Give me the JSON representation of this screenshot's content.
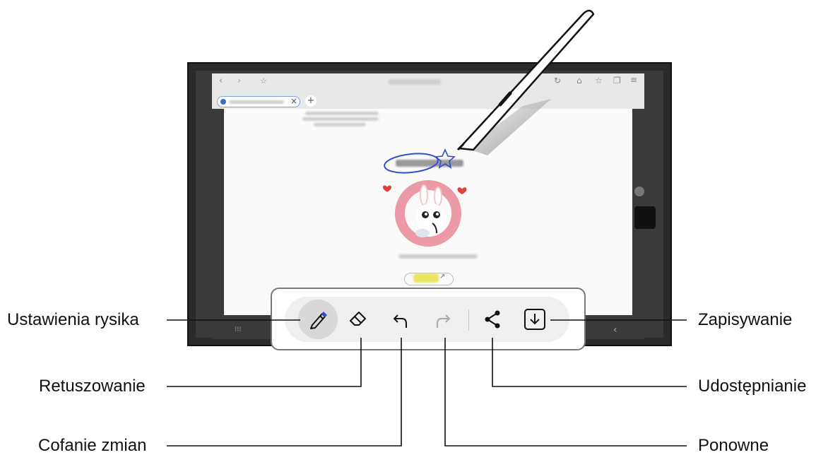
{
  "labels": {
    "pen_settings": "Ustawienia rysika",
    "eraser": "Retuszowanie",
    "undo": "Cofanie zmian",
    "save": "Zapisywanie",
    "share": "Udostępnianie",
    "redo": "Ponowne"
  },
  "toolbar": {
    "buttons": [
      {
        "name": "pen-settings",
        "icon": "pen-icon"
      },
      {
        "name": "eraser",
        "icon": "eraser-icon"
      },
      {
        "name": "undo",
        "icon": "undo-icon"
      },
      {
        "name": "redo",
        "icon": "redo-icon"
      },
      {
        "name": "share",
        "icon": "share-icon"
      },
      {
        "name": "save",
        "icon": "download-icon"
      }
    ]
  },
  "browser": {
    "new_tab": "+",
    "close_tab": "×"
  },
  "colors": {
    "annotation_blue": "#2f4fd1",
    "heart_red": "#e0413e",
    "ring_pink": "#ec9aa8",
    "highlight_yellow": "#e7e34a"
  }
}
